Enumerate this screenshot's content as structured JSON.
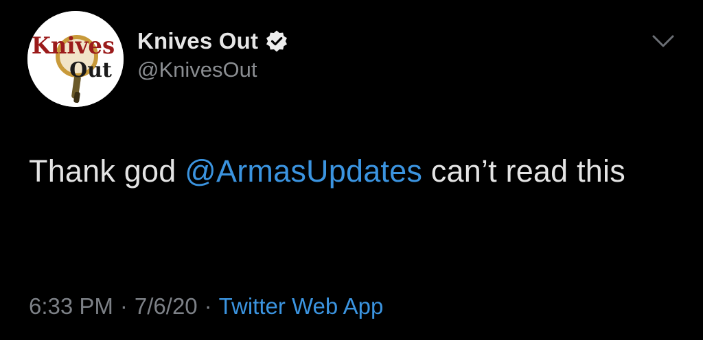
{
  "author": {
    "display_name": "Knives Out",
    "handle": "@KnivesOut",
    "verified": true,
    "avatar_logo_text_1": "Knives",
    "avatar_logo_text_2": "Out"
  },
  "tweet": {
    "text_before": "Thank god ",
    "mention": "@ArmasUpdates",
    "text_after": " can’t read this"
  },
  "meta": {
    "time": "6:33 PM",
    "separator_1": "·",
    "date": "7/6/20",
    "separator_2": "·",
    "source": "Twitter Web App"
  },
  "icons": {
    "verified": "verified-badge-icon",
    "caret": "chevron-down-icon"
  },
  "colors": {
    "background": "#000000",
    "link": "#3b94e0",
    "secondary_text": "#8a8d91",
    "primary_text": "#e4e4e4",
    "logo_red": "#9b1b1b"
  }
}
